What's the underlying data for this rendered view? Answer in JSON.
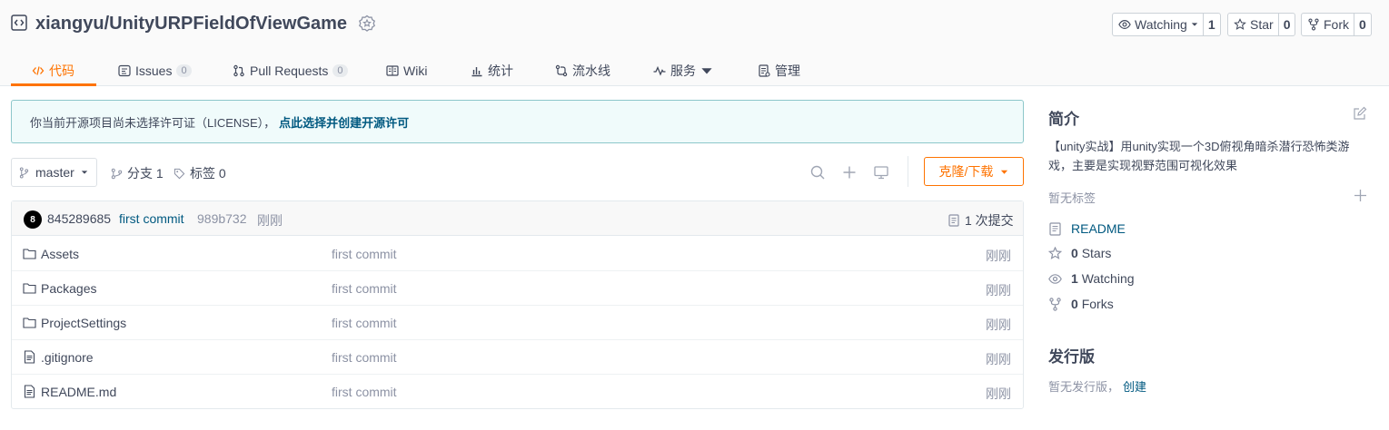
{
  "repo": {
    "title": "xiangyu/UnityURPFieldOfViewGame",
    "watch_label": "Watching",
    "watch_count": "1",
    "star_label": "Star",
    "star_count": "0",
    "fork_label": "Fork",
    "fork_count": "0"
  },
  "tabs": [
    {
      "label": "代码",
      "icon": "code-icon",
      "active": true
    },
    {
      "label": "Issues",
      "count": "0",
      "icon": "issues-icon"
    },
    {
      "label": "Pull Requests",
      "count": "0",
      "icon": "pull-request-icon"
    },
    {
      "label": "Wiki",
      "icon": "wiki-icon"
    },
    {
      "label": "统计",
      "icon": "stats-icon"
    },
    {
      "label": "流水线",
      "icon": "pipeline-icon"
    },
    {
      "label": "服务",
      "icon": "service-icon"
    },
    {
      "label": "管理",
      "icon": "manage-icon"
    }
  ],
  "banner": {
    "text": "你当前开源项目尚未选择许可证（LICENSE），",
    "link": "点此选择并创建开源许可"
  },
  "branch": {
    "current": "master",
    "branches_label": "分支 1",
    "tags_label": "标签 0",
    "clone_label": "克隆/下载"
  },
  "commit": {
    "avatar_letter": "8",
    "author": "845289685",
    "message": "first commit",
    "sha": "989b732",
    "time": "刚刚",
    "count_label": "1 次提交"
  },
  "files": [
    {
      "name": "Assets",
      "type": "folder",
      "message": "first commit",
      "time": "刚刚"
    },
    {
      "name": "Packages",
      "type": "folder",
      "message": "first commit",
      "time": "刚刚"
    },
    {
      "name": "ProjectSettings",
      "type": "folder",
      "message": "first commit",
      "time": "刚刚"
    },
    {
      "name": ".gitignore",
      "type": "file",
      "message": "first commit",
      "time": "刚刚"
    },
    {
      "name": "README.md",
      "type": "file",
      "message": "first commit",
      "time": "刚刚"
    }
  ],
  "sidebar": {
    "intro_title": "简介",
    "description": "【unity实战】用unity实现一个3D俯视角暗杀潜行恐怖类游戏，主要是实现视野范围可视化效果",
    "no_tags": "暂无标签",
    "readme": "README",
    "stars_count": "0",
    "stars_label": "Stars",
    "watching_count": "1",
    "watching_label": "Watching",
    "forks_count": "0",
    "forks_label": "Forks",
    "release_title": "发行版",
    "no_release": "暂无发行版，",
    "create_link": "创建"
  },
  "colors": {
    "accent": "#fe7300",
    "link": "#005980",
    "banner_bg": "#f0fbfb"
  }
}
